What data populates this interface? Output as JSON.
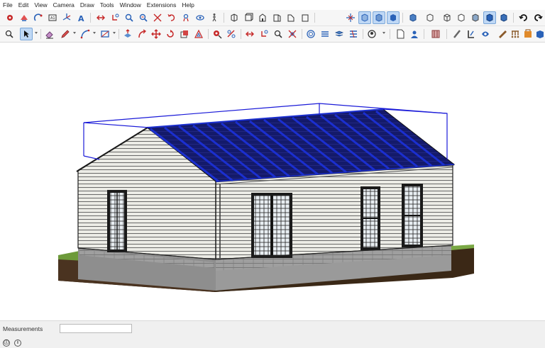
{
  "menu": [
    "File",
    "Edit",
    "View",
    "Camera",
    "Draw",
    "Tools",
    "Window",
    "Extensions",
    "Help"
  ],
  "toolbar_row1": [
    "select-icon",
    "eraser-icon",
    "component-icon",
    "text-icon",
    "axes-icon",
    "3d-text-icon",
    "push-pull-icon",
    "move-icon",
    "rotate-icon",
    "scale-icon",
    "follow-me-icon",
    "offset-icon",
    "orbit-icon",
    "pan-icon",
    "zoom-icon",
    "zoom-window-icon",
    "zoom-extents-icon",
    "previous-view-icon",
    "position-camera-icon",
    "look-around-icon",
    "walk-icon",
    "iso-view-icon",
    "top-view-icon",
    "front-view-icon",
    "right-view-icon",
    "back-view-icon",
    "left-view-icon",
    "section-plane-icon",
    "display-section-planes-icon",
    "display-section-cuts-icon",
    "section-fill-icon",
    "x-ray-icon",
    "back-edges-icon",
    "wireframe-icon",
    "hidden-line-icon",
    "shaded-icon",
    "shaded-textures-icon",
    "monochrome-icon",
    "redo-icon",
    "undo-icon"
  ],
  "toolbar_row2": [
    "zoom-icon",
    "select-icon",
    "eraser-icon",
    "pencil-icon",
    "arc-icon",
    "shape-icon",
    "push-pull-icon",
    "follow-me-icon",
    "move-icon",
    "rotate-icon",
    "scale-icon",
    "offset-icon",
    "tape-measure-icon",
    "dimension-icon",
    "protractor-icon",
    "text-icon",
    "orbit-icon",
    "pan-icon",
    "zoom-icon",
    "zoom-extents-icon",
    "3d-warehouse-icon",
    "extension-warehouse-icon",
    "layout-icon",
    "extension-manager-icon",
    "geo-location-icon",
    "new-file-icon",
    "account-icon",
    "materials-icon",
    "components-icon",
    "styles-icon",
    "tags-icon",
    "scenes-icon",
    "outliner-icon",
    "entity-info-icon",
    "instructor-icon"
  ],
  "status": {
    "measurements_label": "Measurements",
    "measurements_value": ""
  },
  "colors": {
    "toolbar_bg": "#f6f6f6",
    "selection_box": "#1a1ad8",
    "solar_panel": "#1b2fd0",
    "siding": "#e9e9e4",
    "grass": "#6d9a3a",
    "soil": "#3d2a18",
    "foundation": "#9e9e9e"
  }
}
